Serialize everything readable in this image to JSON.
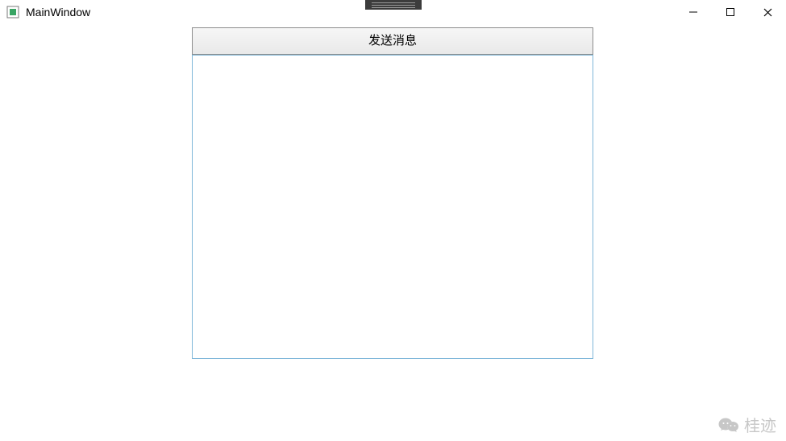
{
  "window": {
    "title": "MainWindow"
  },
  "button": {
    "send_label": "发送消息"
  },
  "panel": {
    "content": ""
  },
  "watermark": {
    "text": "桂迹"
  }
}
